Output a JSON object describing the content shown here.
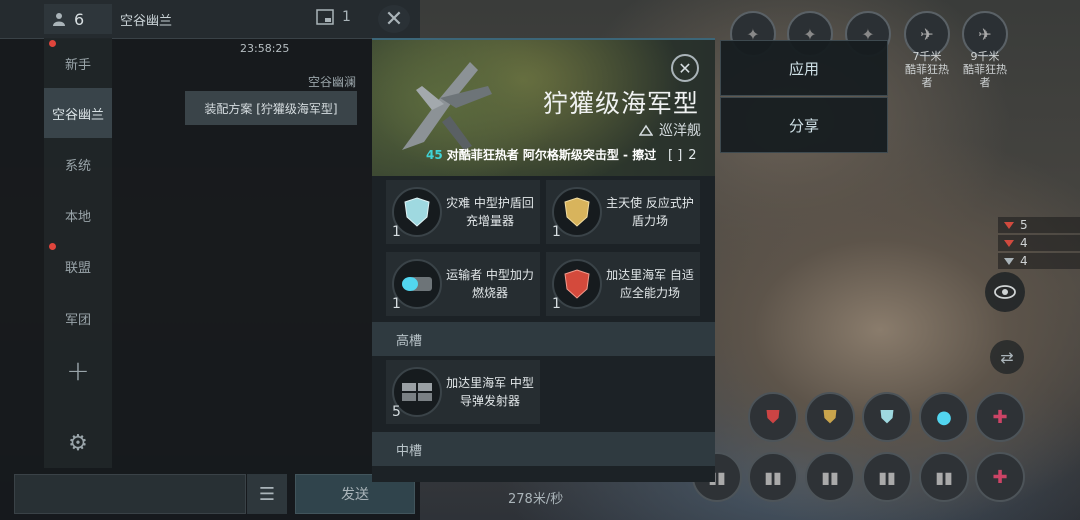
{
  "chat": {
    "user_count": "6",
    "title": "空谷幽兰",
    "member_count": "1",
    "timestamp": "23:58:25",
    "message_sender": "空谷幽澜",
    "message_text": "装配方案 [狞獾级海军型]",
    "input_placeholder": "",
    "send_label": "发送",
    "sidebar": [
      {
        "label": "新手",
        "badge": true
      },
      {
        "label": "空谷幽兰",
        "badge": false,
        "active": true
      },
      {
        "label": "系统",
        "badge": false
      },
      {
        "label": "本地",
        "badge": false
      },
      {
        "label": "联盟",
        "badge": true
      },
      {
        "label": "军团",
        "badge": false
      }
    ]
  },
  "hud": {
    "top_slots": [
      {
        "label": ""
      },
      {
        "label": ""
      },
      {
        "label": ""
      },
      {
        "label": "7千米\n酷菲狂热者"
      },
      {
        "label": "9千米\n酷菲狂热者"
      }
    ],
    "stats": [
      "5",
      "4",
      "4"
    ],
    "speed": "278米/秒"
  },
  "actions": {
    "apply_label": "应用",
    "share_label": "分享"
  },
  "fitting": {
    "ship_name": "狞獾级海军型",
    "ship_class": "巡洋舰",
    "killfeed_number": "45",
    "killfeed_text": "对酷菲狂热者 阿尔格斯级突击型 - 擦过",
    "slot_count": "2",
    "low_slots": [
      {
        "name": "灾难 中型护盾回充增量器",
        "qty": "1",
        "color": "#9fd9e0"
      },
      {
        "name": "主天使 反应式护盾力场",
        "qty": "1",
        "color": "#d8b45c"
      },
      {
        "name": "运输者 中型加力燃烧器",
        "qty": "1",
        "color": "#52d6f0"
      },
      {
        "name": "加达里海军 自适应全能力场",
        "qty": "1",
        "color": "#d44a3c"
      }
    ],
    "high_section": "高槽",
    "high_slots": [
      {
        "name": "加达里海军 中型导弹发射器",
        "qty": "5"
      }
    ],
    "mid_section": "中槽"
  }
}
